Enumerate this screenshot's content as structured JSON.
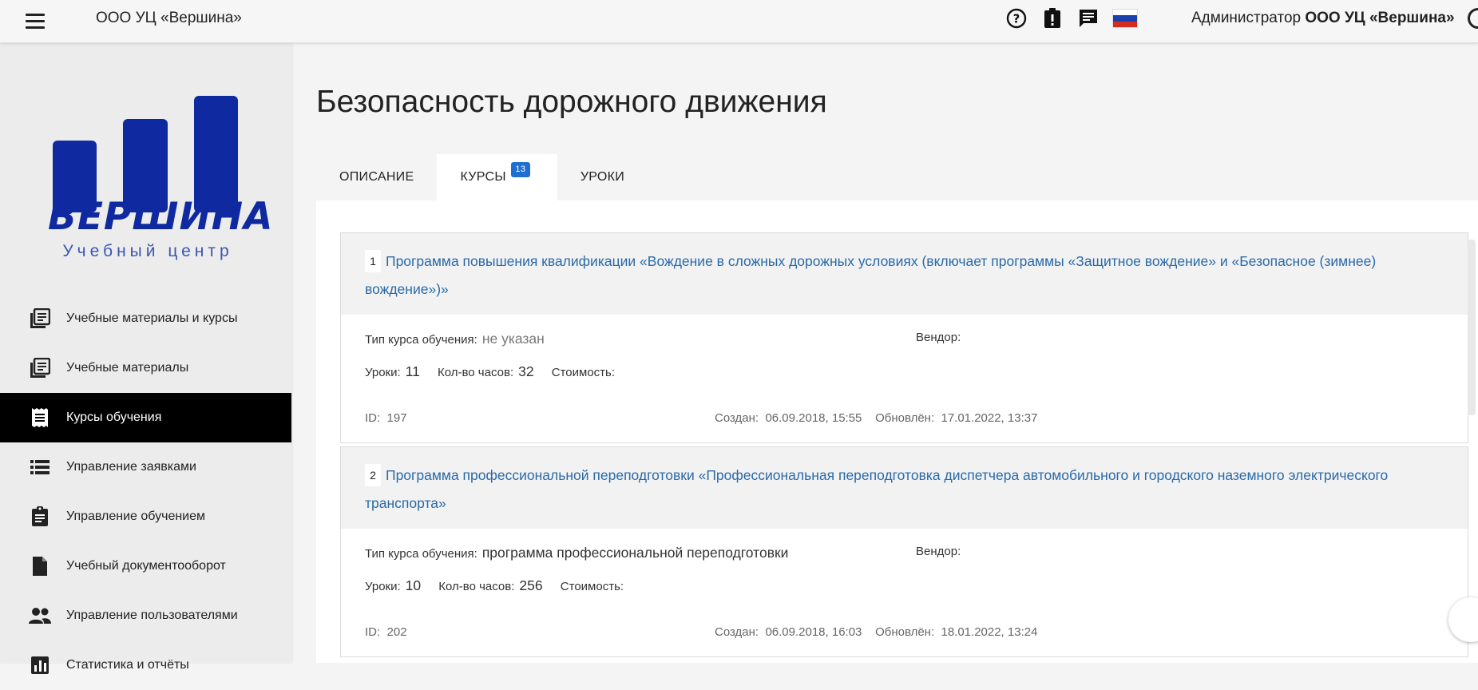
{
  "topbar": {
    "org_title": "ООО УЦ «Вершина»",
    "icons": [
      "help-icon",
      "alert-icon",
      "chat-icon",
      "russian-flag-icon"
    ],
    "user_prefix": "Администратор",
    "user_org": "ООО УЦ «Вершина»"
  },
  "logo": {
    "title": "ВЕРШИНА",
    "subtitle": "Учебный центр",
    "color": "#0f2aa0"
  },
  "sidebar": {
    "items": [
      {
        "label": "Учебные материалы и курсы",
        "icon": "library-books-icon"
      },
      {
        "label": "Учебные материалы",
        "icon": "library-books-icon"
      },
      {
        "label": "Курсы обучения",
        "icon": "receipt-icon",
        "active": true
      },
      {
        "label": "Управление заявками",
        "icon": "list-icon"
      },
      {
        "label": "Управление обучением",
        "icon": "assignment-icon"
      },
      {
        "label": "Учебный документооборот",
        "icon": "document-icon"
      },
      {
        "label": "Управление пользователями",
        "icon": "people-icon"
      },
      {
        "label": "Статистика и отчёты",
        "icon": "chart-icon"
      }
    ]
  },
  "page": {
    "title": "Безопасность дорожного движения"
  },
  "tabs": [
    {
      "label": "ОПИСАНИЕ"
    },
    {
      "label": "КУРСЫ",
      "badge": "13",
      "active": true
    },
    {
      "label": "УРОКИ"
    }
  ],
  "courses": [
    {
      "num": "1",
      "title": "Программа повышения квалификации «Вождение в сложных дорожных условиях (включает программы «Защитное вождение» и «Безопасное (зимнее) вождение»)»",
      "type_label": "Тип курса обучения:",
      "type_value": "не указан",
      "vendor_label": "Вендор:",
      "lessons_label": "Уроки:",
      "lessons": "11",
      "hours_label": "Кол-во часов:",
      "hours": "32",
      "cost_label": "Стоимость:",
      "id_label": "ID:",
      "id": "197",
      "created_label": "Создан:",
      "created": "06.09.2018, 15:55",
      "updated_label": "Обновлён:",
      "updated": "17.01.2022, 13:37"
    },
    {
      "num": "2",
      "title": "Программа профессиональной переподготовки «Профессиональная переподготовка диспетчера автомобильного и городского наземного электрического транспорта»",
      "type_label": "Тип курса обучения:",
      "type_value": "программа профессиональной переподготовки",
      "vendor_label": "Вендор:",
      "lessons_label": "Уроки:",
      "lessons": "10",
      "hours_label": "Кол-во часов:",
      "hours": "256",
      "cost_label": "Стоимость:",
      "id_label": "ID:",
      "id": "202",
      "created_label": "Создан:",
      "created": "06.09.2018, 16:03",
      "updated_label": "Обновлён:",
      "updated": "18.01.2022, 13:24"
    }
  ]
}
